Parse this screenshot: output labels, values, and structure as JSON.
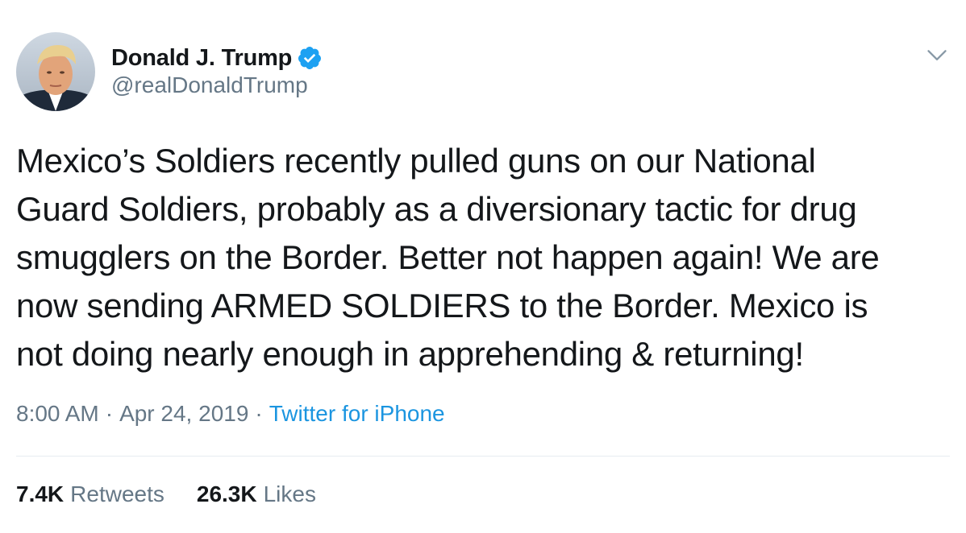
{
  "author": {
    "display_name": "Donald J. Trump",
    "handle": "@realDonaldTrump",
    "verified": true
  },
  "icons": {
    "avatar": "profile-photo",
    "verified": "verified-badge-icon",
    "menu": "chevron-down-icon"
  },
  "tweet": {
    "text": "Mexico’s Soldiers recently pulled guns on our National\nGuard Soldiers, probably as a diversionary tactic for drug\nsmugglers on the Border. Better not happen again! We are\nnow sending ARMED SOLDIERS to the Border. Mexico is\nnot doing nearly enough in apprehending & returning!",
    "time": "8:00 AM",
    "separator": "·",
    "date": "Apr 24, 2019",
    "source": "Twitter for iPhone"
  },
  "stats": {
    "retweets_count": "7.4K",
    "retweets_label": "Retweets",
    "likes_count": "26.3K",
    "likes_label": "Likes"
  },
  "colors": {
    "text": "#14171a",
    "secondary": "#657786",
    "link": "#1b95e0",
    "verified": "#1da1f2",
    "divider": "#e6ecf0"
  }
}
